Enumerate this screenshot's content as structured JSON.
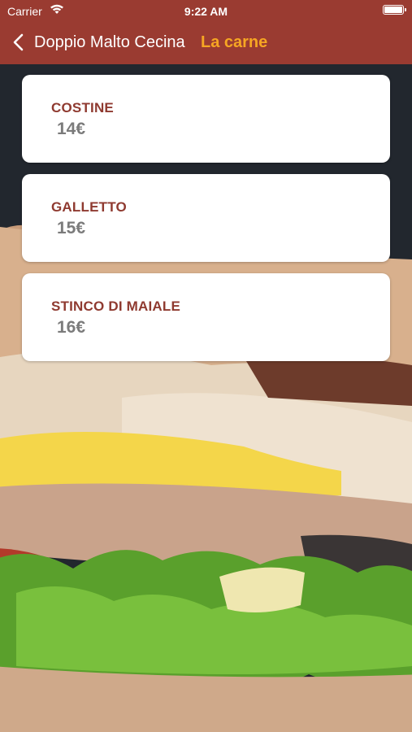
{
  "status_bar": {
    "carrier": "Carrier",
    "time": "9:22 AM"
  },
  "nav": {
    "title": "Doppio Malto Cecina",
    "subtitle": "La carne"
  },
  "items": [
    {
      "name": "COSTINE",
      "price": "14€"
    },
    {
      "name": "GALLETTO",
      "price": "15€"
    },
    {
      "name": "STINCO DI MAIALE",
      "price": "16€"
    }
  ],
  "colors": {
    "header": "#9a3b31",
    "accent": "#f6a623",
    "item_name": "#8f3a30",
    "price": "#7b7b7b"
  },
  "icons": [
    "wifi-icon",
    "battery-icon",
    "back-chevron-icon"
  ]
}
